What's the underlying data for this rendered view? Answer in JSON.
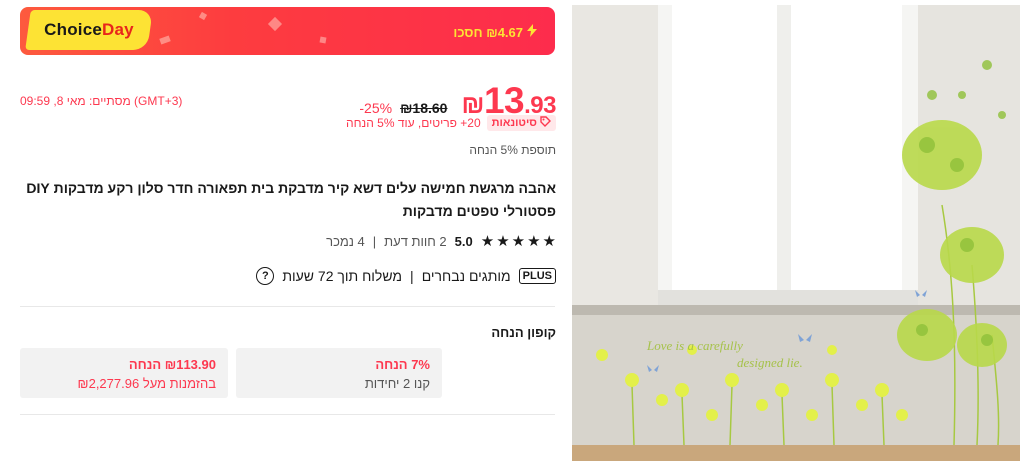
{
  "banner": {
    "choice_part1": "Choice",
    "choice_part2": "Day",
    "save_text": "₪4.67 חסכו"
  },
  "price": {
    "currency": "₪",
    "main": "13",
    "decimals": ".93",
    "old": "₪18.60",
    "discount": "-25%"
  },
  "countdown": "מסתיים: מאי 8, 09:59 (GMT+3)",
  "wholesale": {
    "badge": "סיטונאות",
    "text": "20+ פריטים, עוד 5% הנחה"
  },
  "extra_note": "תוספת 5% הנחה",
  "title": "אהבה מרגשת חמישה עלים דשא קיר מדבקת בית תפאורה חדר סלון רקע מדבקות DIY פסטורלי טפטים מדבקות",
  "rating": {
    "value": "5.0",
    "reviews": "2 חוות דעת",
    "separator": "|",
    "sold": "4 נמכר",
    "stars": 5
  },
  "shipping": {
    "plus": "PLUS",
    "brands": "מותגים נבחרים",
    "separator": "|",
    "delivery": "משלוח תוך 72 שעות",
    "help": "?"
  },
  "coupon": {
    "title": "קופון הנחה",
    "items": [
      {
        "line1": "7% הנחה",
        "line2": "קנו 2 יחידות"
      },
      {
        "line1": "₪113.90 הנחה",
        "line2": "בהזמנות מעל ₪2,277.96"
      }
    ]
  },
  "image": {
    "overlay_text_1": "Love is a carefully",
    "overlay_text_2": "designed lie."
  },
  "colors": {
    "accent": "#fd384f",
    "banner": "#fd3c3f",
    "choice_yellow": "#fde334"
  }
}
